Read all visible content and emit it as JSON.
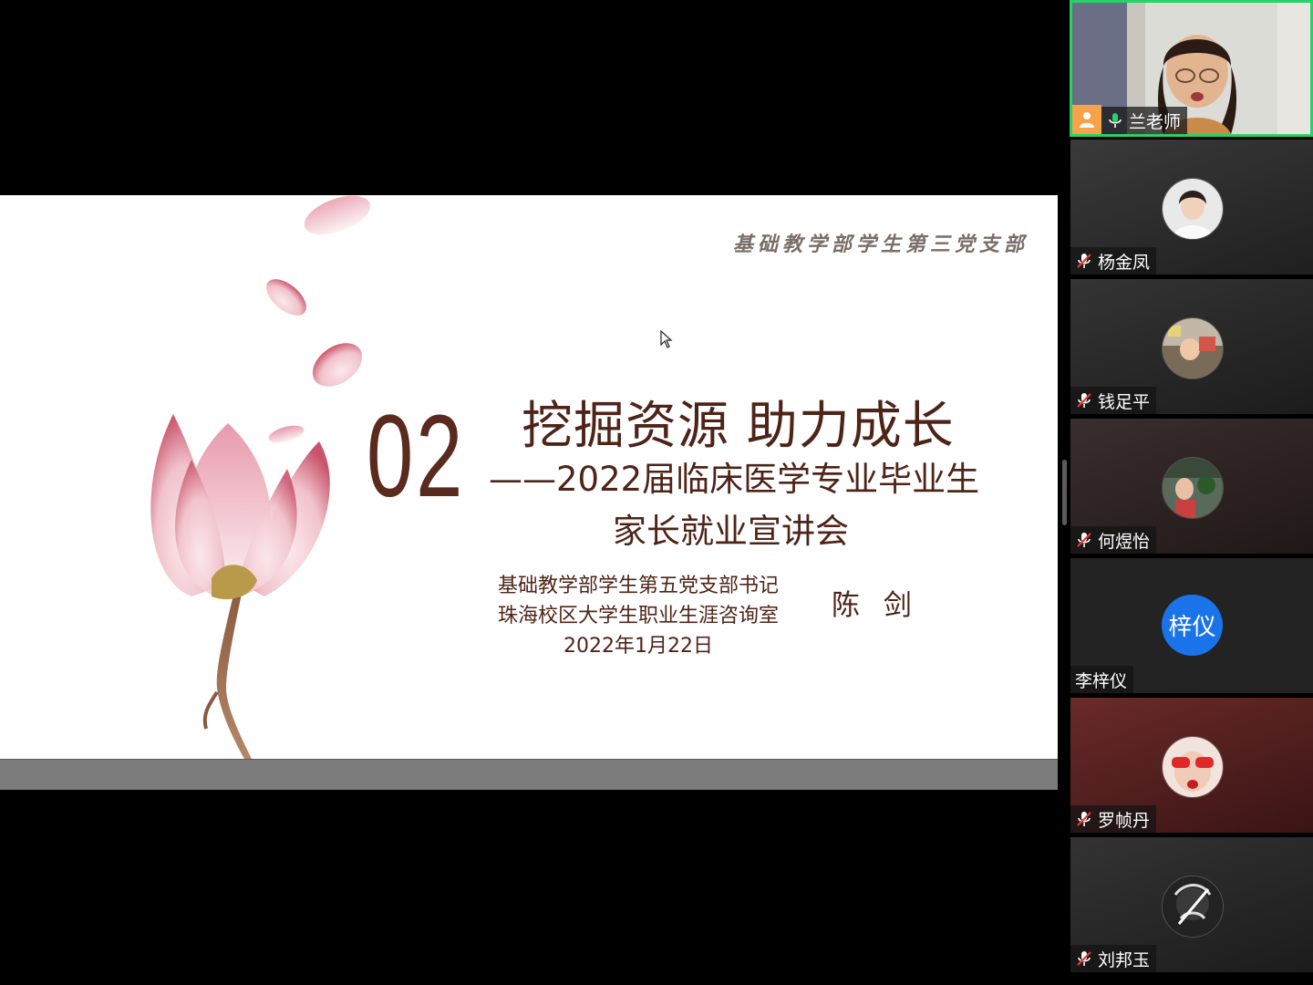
{
  "slide": {
    "dept_header": "基础教学部学生第三党支部",
    "number": "02",
    "title_main": "挖掘资源 助力成长",
    "title_sub": "——2022届临床医学专业毕业生",
    "title_sub2": "家长就业宣讲会",
    "presenter_line1": "基础教学部学生第五党支部书记",
    "presenter_line2": "珠海校区大学生职业生涯咨询室",
    "presenter_date": "2022年1月22日",
    "presenter_name": "陈 剑"
  },
  "participants": [
    {
      "name": "兰老师",
      "mic": "on",
      "video": true,
      "host": true
    },
    {
      "name": "杨金凤",
      "mic": "muted"
    },
    {
      "name": "钱足平",
      "mic": "muted"
    },
    {
      "name": "何煜怡",
      "mic": "muted"
    },
    {
      "name": "李梓仪",
      "mic": "none",
      "avatar_text": "梓仪"
    },
    {
      "name": "罗帧丹",
      "mic": "muted"
    },
    {
      "name": "刘邦玉",
      "mic": "muted"
    }
  ],
  "colors": {
    "active_speaker_border": "#25d366",
    "title_brown": "#4e2418",
    "text_avatar_blue": "#1a73e8",
    "host_badge": "#f5a24a"
  }
}
